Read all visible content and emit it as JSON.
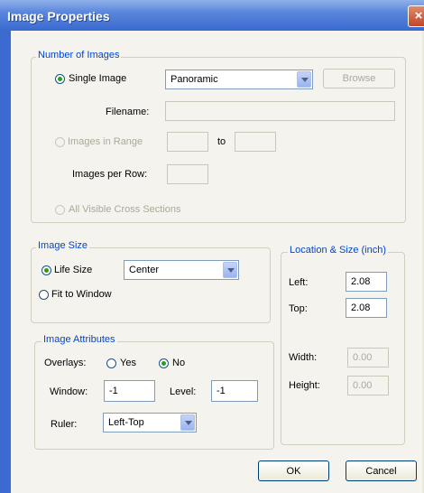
{
  "window": {
    "title": "Image Properties",
    "close_symbol": "×"
  },
  "number_of_images": {
    "legend": "Number of Images",
    "single_image_label": "Single Image",
    "type_combo_value": "Panoramic",
    "browse_label": "Browse",
    "filename_label": "Filename:",
    "filename_value": "",
    "images_in_range_label": "Images in Range",
    "range_from": "",
    "range_to_label": "to",
    "range_to": "",
    "images_per_row_label": "Images per Row:",
    "images_per_row": "",
    "all_visible_label": "All Visible Cross Sections"
  },
  "image_size": {
    "legend": "Image Size",
    "life_size_label": "Life Size",
    "fit_window_label": "Fit to Window",
    "position_combo_value": "Center"
  },
  "image_attributes": {
    "legend": "Image Attributes",
    "overlays_label": "Overlays:",
    "yes_label": "Yes",
    "no_label": "No",
    "window_label": "Window:",
    "window_value": "-1",
    "level_label": "Level:",
    "level_value": "-1",
    "ruler_label": "Ruler:",
    "ruler_value": "Left-Top"
  },
  "location_size": {
    "legend": "Location & Size (inch)",
    "left_label": "Left:",
    "left_value": "2.08",
    "top_label": "Top:",
    "top_value": "2.08",
    "width_label": "Width:",
    "width_value": "0.00",
    "height_label": "Height:",
    "height_value": "0.00"
  },
  "buttons": {
    "ok": "OK",
    "cancel": "Cancel"
  }
}
